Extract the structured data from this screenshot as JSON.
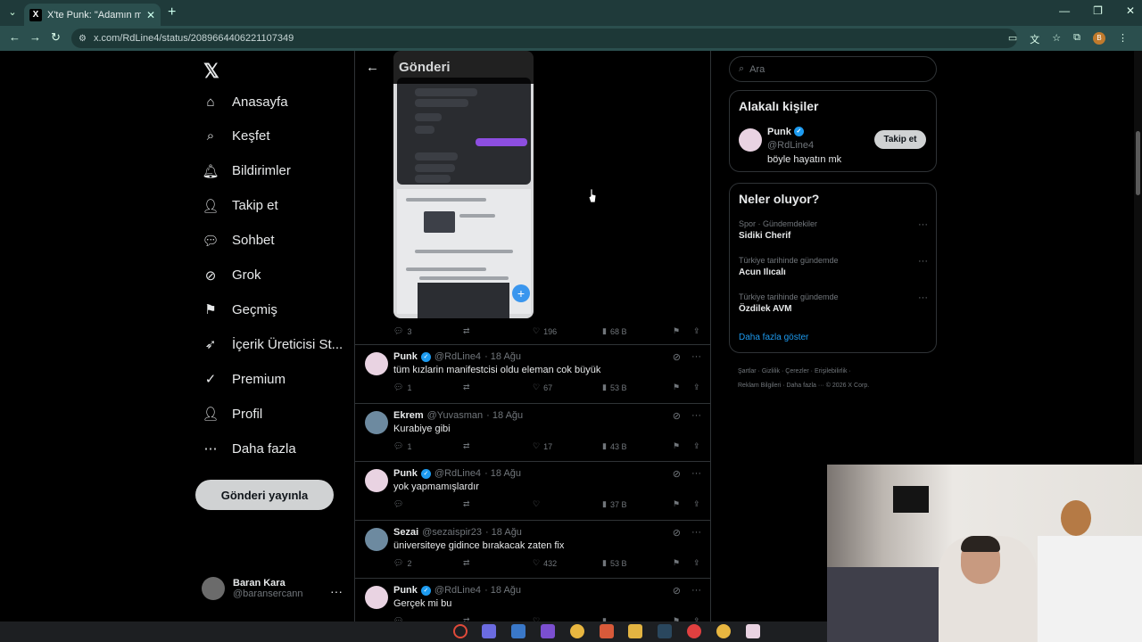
{
  "browser": {
    "tab_title": "X'te Punk: \"Adamın manita baş",
    "url": "x.com/RdLine4/status/2089664406221107349"
  },
  "nav": {
    "items": [
      {
        "label": "Anasayfa",
        "icon": "home-icon"
      },
      {
        "label": "Keşfet",
        "icon": "search-icon"
      },
      {
        "label": "Bildirimler",
        "icon": "bell-icon"
      },
      {
        "label": "Takip et",
        "icon": "add-person-icon"
      },
      {
        "label": "Sohbet",
        "icon": "chat-icon"
      },
      {
        "label": "Grok",
        "icon": "grok-icon"
      },
      {
        "label": "Geçmiş",
        "icon": "bookmark-icon"
      },
      {
        "label": "İçerik Üreticisi St...",
        "icon": "rocket-icon"
      },
      {
        "label": "Premium",
        "icon": "premium-icon"
      },
      {
        "label": "Profil",
        "icon": "profile-icon"
      },
      {
        "label": "Daha fazla",
        "icon": "more-icon"
      }
    ],
    "post_button": "Gönderi yayınla",
    "user": {
      "name": "Baran Kara",
      "handle": "@baransercann"
    }
  },
  "main": {
    "header_title": "Gönderi",
    "main_post_stats": {
      "replies": "3",
      "likes": "196",
      "views": "68 B"
    },
    "tweets": [
      {
        "name": "Punk",
        "verified": true,
        "handle": "@RdLine4",
        "time": "· 18 Ağu",
        "text": "tüm kızlarin manifestcisi oldu eleman cok büyük",
        "replies": "1",
        "likes": "67",
        "views": "53 B"
      },
      {
        "name": "Ekrem",
        "verified": false,
        "handle": "@Yuvasman",
        "time": "· 18 Ağu",
        "text": "Kurabiye gibi",
        "replies": "1",
        "likes": "17",
        "views": "43 B"
      },
      {
        "name": "Punk",
        "verified": true,
        "handle": "@RdLine4",
        "time": "· 18 Ağu",
        "text": "yok yapmamışlardır",
        "replies": "",
        "likes": "",
        "views": "37 B"
      },
      {
        "name": "Sezai",
        "verified": false,
        "handle": "@sezaispir23",
        "time": "· 18 Ağu",
        "text": "üniversiteye gidince bırakacak zaten fix",
        "replies": "2",
        "likes": "432",
        "views": "53 B"
      },
      {
        "name": "Punk",
        "verified": true,
        "handle": "@RdLine4",
        "time": "· 18 Ağu",
        "text": "Gerçek mi bu",
        "replies": "",
        "likes": "",
        "views": ""
      }
    ]
  },
  "sidebar": {
    "search_placeholder": "Ara",
    "related_title": "Alakalı kişiler",
    "person": {
      "name": "Punk",
      "handle": "@RdLine4",
      "bio": "böyle hayatın mk",
      "follow_label": "Takip et"
    },
    "trends_title": "Neler oluyor?",
    "trends": [
      {
        "context": "Spor · Gündemdekiler",
        "name": "Sidiki Cherif"
      },
      {
        "context": "Türkiye tarihinde gündemde",
        "name": "Acun Ilıcalı"
      },
      {
        "context": "Türkiye tarihinde gündemde",
        "name": "Özdilek AVM"
      }
    ],
    "show_more": "Daha fazla göster",
    "footer_line1": "Şartlar · Gizlilik · Çerezler · Erişilebilirlik ·",
    "footer_line2": "Reklam Bilgileri · Daha fazla ··· © 2026 X Corp."
  },
  "colors": {
    "accent": "#1d9bf0",
    "browser_frame": "#2b4f4e",
    "background": "#000000"
  }
}
